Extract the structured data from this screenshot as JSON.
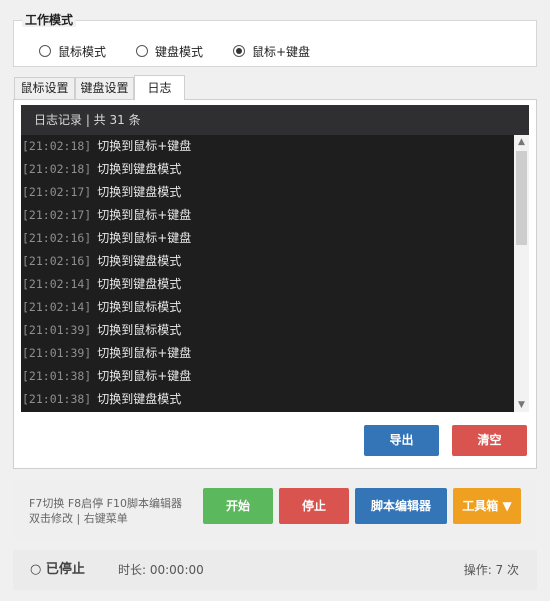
{
  "mode": {
    "legend": "工作模式",
    "options": [
      {
        "label": "鼠标模式",
        "checked": false
      },
      {
        "label": "键盘模式",
        "checked": false
      },
      {
        "label": "鼠标+键盘",
        "checked": true
      }
    ]
  },
  "tabs": [
    {
      "label": "鼠标设置",
      "active": false
    },
    {
      "label": "键盘设置",
      "active": false
    },
    {
      "label": "日志",
      "active": true
    }
  ],
  "log": {
    "header": "日志记录 | 共 31 条",
    "entries": [
      {
        "time": "[21:02:18]",
        "msg": "切换到鼠标+键盘"
      },
      {
        "time": "[21:02:18]",
        "msg": "切换到键盘模式"
      },
      {
        "time": "[21:02:17]",
        "msg": "切换到键盘模式"
      },
      {
        "time": "[21:02:17]",
        "msg": "切换到鼠标+键盘"
      },
      {
        "time": "[21:02:16]",
        "msg": "切换到鼠标+键盘"
      },
      {
        "time": "[21:02:16]",
        "msg": "切换到键盘模式"
      },
      {
        "time": "[21:02:14]",
        "msg": "切换到键盘模式"
      },
      {
        "time": "[21:02:14]",
        "msg": "切换到鼠标模式"
      },
      {
        "time": "[21:01:39]",
        "msg": "切换到鼠标模式"
      },
      {
        "time": "[21:01:39]",
        "msg": "切换到鼠标+键盘"
      },
      {
        "time": "[21:01:38]",
        "msg": "切换到鼠标+键盘"
      },
      {
        "time": "[21:01:38]",
        "msg": "切换到键盘模式"
      }
    ],
    "scroll_up_icon": "chevron-up-icon",
    "scroll_down_icon": "chevron-down-icon"
  },
  "log_actions": {
    "export_label": "导出",
    "clear_label": "清空"
  },
  "controls": {
    "hint_line1": "F7切换 F8启停 F10脚本编辑器",
    "hint_line2": "双击修改 | 右键菜单",
    "start_label": "开始",
    "stop_label": "停止",
    "editor_label": "脚本编辑器",
    "toolbox_label": "工具箱 ▼"
  },
  "status": {
    "state": "○ 已停止",
    "duration": "时长: 00:00:00",
    "operations": "操作: 7 次"
  },
  "colors": {
    "blue": "#3375b7",
    "red": "#d9534f",
    "green": "#5cb85c",
    "orange": "#f0a020",
    "log_bg": "#1e1e1e",
    "log_header_bg": "#2f2f31"
  }
}
